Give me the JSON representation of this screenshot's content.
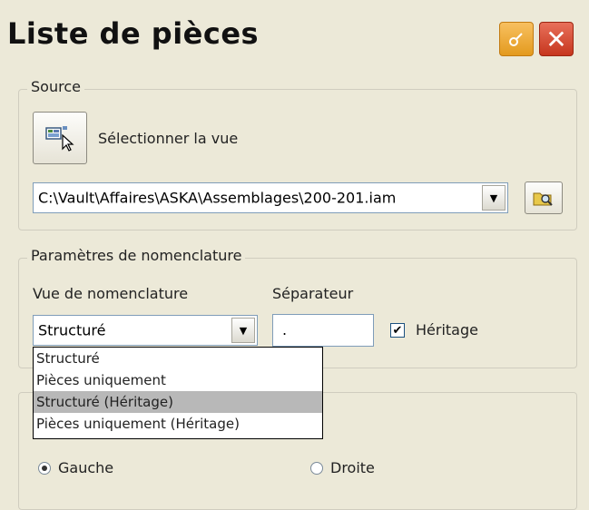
{
  "window": {
    "title": "Liste de pièces",
    "pin_icon": "pin-icon",
    "close_icon": "close-icon",
    "close_glyph": "✕"
  },
  "source": {
    "legend": "Source",
    "select_view_label": "Sélectionner la vue",
    "file_path": "C:\\Vault\\Affaires\\ASKA\\Assemblages\\200-201.iam"
  },
  "bom_params": {
    "legend": "Paramètres de nomenclature",
    "bom_view_label": "Vue de nomenclature",
    "bom_view_value": "Structuré",
    "separator_label": "Séparateur",
    "separator_value": ".",
    "inheritance_label": "Héritage",
    "inheritance_checked": true,
    "dropdown_options": [
      "Structuré",
      "Pièces uniquement",
      "Structuré (Héritage)",
      "Pièces uniquement (Héritage)"
    ],
    "highlighted_option": "Structuré (Héritage)"
  },
  "alignment": {
    "left_label": "Gauche",
    "right_label": "Droite",
    "selected": "Gauche"
  },
  "colors": {
    "dialog_bg": "#ECE9D8",
    "close_red": "#C6361E",
    "pin_orange": "#E39A1E",
    "highlight_gray": "#B8B8B8"
  }
}
